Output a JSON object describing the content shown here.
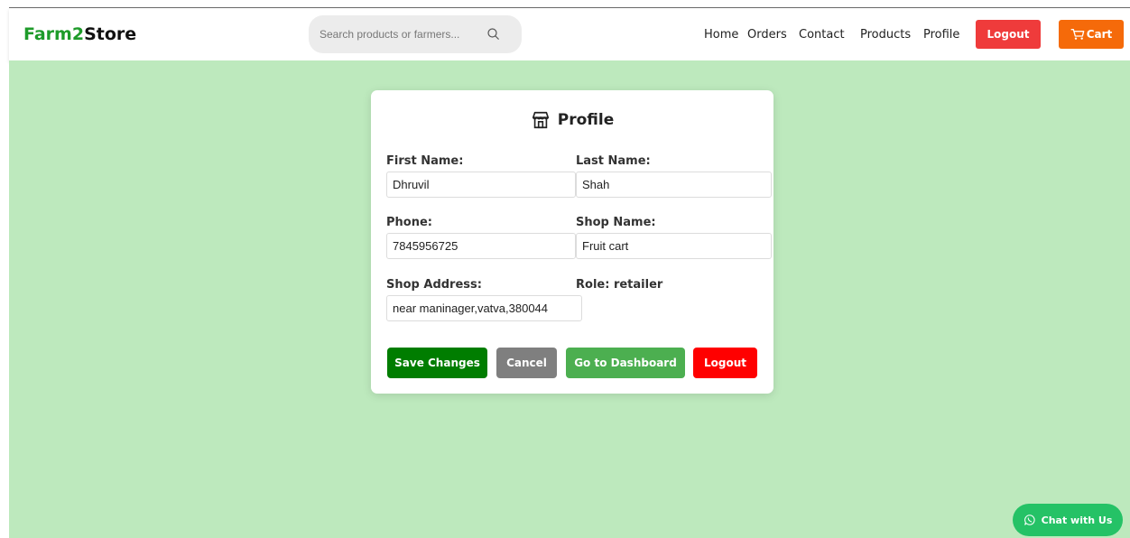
{
  "navbar": {
    "logo_part1": "Farm2",
    "logo_part2": "Store",
    "search_placeholder": "Search products or farmers...",
    "links": [
      "Home",
      "Orders",
      "Contact",
      "Products",
      "Profile"
    ],
    "logout_label": "Logout",
    "cart_label": "Cart"
  },
  "profile": {
    "title": "Profile",
    "first_name_label": "First Name:",
    "first_name": "Dhruvil",
    "last_name_label": "Last Name:",
    "last_name": "Shah",
    "phone_label": "Phone:",
    "phone": "7845956725",
    "shop_name_label": "Shop Name:",
    "shop_name": "Fruit cart",
    "shop_address_label": "Shop Address:",
    "shop_address": "near maninager,vatva,380044",
    "role_label": "Role:",
    "role_value": "retailer"
  },
  "actions": {
    "save": "Save Changes",
    "cancel": "Cancel",
    "dashboard": "Go to Dashboard",
    "logout": "Logout"
  },
  "chat": {
    "label": "Chat with Us"
  },
  "colors": {
    "brand_green": "#1e9b2a",
    "background": "#bde9bd",
    "save": "#007d00",
    "cancel": "#7f7f7f",
    "dashboard": "#4caf50",
    "logout": "#ff0000",
    "cart": "#f56a0a",
    "chat": "#25c266"
  }
}
